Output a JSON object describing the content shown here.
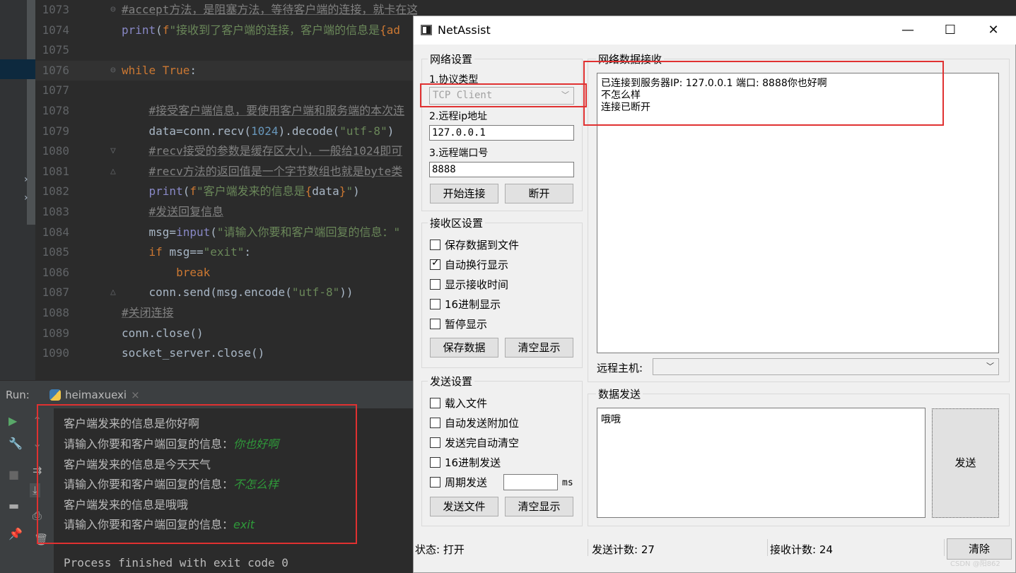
{
  "ide": {
    "lines": [
      {
        "num": "1073",
        "fold": "⊖",
        "html_parts": [
          {
            "cls": "c-cmt",
            "t": "#accept方法，是阻塞方法，等待客户端的连接，就卡在这一行不向下执行了"
          }
        ]
      },
      {
        "num": "1074",
        "fold": "",
        "html_parts": [
          {
            "cls": "c-fn",
            "t": "print"
          },
          {
            "cls": "c-plain",
            "t": "("
          },
          {
            "cls": "c-fs",
            "t": "f"
          },
          {
            "cls": "c-str",
            "t": "\"接收到了客户端的连接，客户端的信息是"
          },
          {
            "cls": "c-fs",
            "t": "{ad"
          }
        ]
      },
      {
        "num": "1075",
        "fold": "",
        "html_parts": []
      },
      {
        "num": "1076",
        "fold": "⊖",
        "html_parts": [
          {
            "cls": "c-kw",
            "t": "while "
          },
          {
            "cls": "c-kw",
            "t": "True"
          },
          {
            "cls": "c-plain",
            "t": ":"
          }
        ]
      },
      {
        "num": "1077",
        "fold": "",
        "html_parts": []
      },
      {
        "num": "1078",
        "fold": "",
        "html_parts": [
          {
            "cls": "c-plain",
            "t": "    "
          },
          {
            "cls": "c-cmt",
            "t": "#接受客户端信息，要使用客户端和服务端的本次连"
          }
        ]
      },
      {
        "num": "1079",
        "fold": "",
        "html_parts": [
          {
            "cls": "c-plain",
            "t": "    data=conn.recv("
          },
          {
            "cls": "c-num",
            "t": "1024"
          },
          {
            "cls": "c-plain",
            "t": ").decode("
          },
          {
            "cls": "c-str",
            "t": "\"utf-8\""
          },
          {
            "cls": "c-plain",
            "t": ")"
          }
        ]
      },
      {
        "num": "1080",
        "fold": "▽",
        "html_parts": [
          {
            "cls": "c-plain",
            "t": "    "
          },
          {
            "cls": "c-cmt",
            "t": "#recv接受的参数是缓存区大小，一般给1024即可"
          }
        ]
      },
      {
        "num": "1081",
        "fold": "△",
        "html_parts": [
          {
            "cls": "c-plain",
            "t": "    "
          },
          {
            "cls": "c-cmt",
            "t": "#recv方法的返回值是一个字节数组也就是byte类"
          }
        ]
      },
      {
        "num": "1082",
        "fold": "",
        "html_parts": [
          {
            "cls": "c-plain",
            "t": "    "
          },
          {
            "cls": "c-fn",
            "t": "print"
          },
          {
            "cls": "c-plain",
            "t": "("
          },
          {
            "cls": "c-fs",
            "t": "f"
          },
          {
            "cls": "c-str",
            "t": "\"客户端发来的信息是"
          },
          {
            "cls": "c-fs",
            "t": "{"
          },
          {
            "cls": "c-plain",
            "t": "data"
          },
          {
            "cls": "c-fs",
            "t": "}"
          },
          {
            "cls": "c-str",
            "t": "\""
          },
          {
            "cls": "c-plain",
            "t": ")"
          }
        ]
      },
      {
        "num": "1083",
        "fold": "",
        "html_parts": [
          {
            "cls": "c-plain",
            "t": "    "
          },
          {
            "cls": "c-cmt",
            "t": "#发送回复信息"
          }
        ]
      },
      {
        "num": "1084",
        "fold": "",
        "html_parts": [
          {
            "cls": "c-plain",
            "t": "    msg="
          },
          {
            "cls": "c-fn",
            "t": "input"
          },
          {
            "cls": "c-plain",
            "t": "("
          },
          {
            "cls": "c-str",
            "t": "\"请输入你要和客户端回复的信息：\""
          }
        ]
      },
      {
        "num": "1085",
        "fold": "",
        "html_parts": [
          {
            "cls": "c-plain",
            "t": "    "
          },
          {
            "cls": "c-kw",
            "t": "if "
          },
          {
            "cls": "c-plain",
            "t": "msg=="
          },
          {
            "cls": "c-str",
            "t": "\"exit\""
          },
          {
            "cls": "c-plain",
            "t": ":"
          }
        ]
      },
      {
        "num": "1086",
        "fold": "",
        "html_parts": [
          {
            "cls": "c-plain",
            "t": "        "
          },
          {
            "cls": "c-kw",
            "t": "break"
          }
        ]
      },
      {
        "num": "1087",
        "fold": "△",
        "html_parts": [
          {
            "cls": "c-plain",
            "t": "    conn.send(msg.encode("
          },
          {
            "cls": "c-str",
            "t": "\"utf-8\""
          },
          {
            "cls": "c-plain",
            "t": "))"
          }
        ]
      },
      {
        "num": "1088",
        "fold": "",
        "html_parts": [
          {
            "cls": "c-cmt",
            "t": "#关闭连接"
          }
        ]
      },
      {
        "num": "1089",
        "fold": "",
        "html_parts": [
          {
            "cls": "c-plain",
            "t": "conn.close()"
          }
        ]
      },
      {
        "num": "1090",
        "fold": "",
        "html_parts": [
          {
            "cls": "c-plain",
            "t": "socket_server.close()"
          }
        ]
      }
    ],
    "run_label": "Run:",
    "run_tab": "heimaxuexi",
    "run_tab_close": "×",
    "output": [
      {
        "text": "客户端发来的信息是你好啊",
        "input": ""
      },
      {
        "text": "请输入你要和客户端回复的信息：",
        "input": "你也好啊"
      },
      {
        "text": "客户端发来的信息是今天天气",
        "input": ""
      },
      {
        "text": "请输入你要和客户端回复的信息：",
        "input": "不怎么样"
      },
      {
        "text": "客户端发来的信息是哦哦",
        "input": ""
      },
      {
        "text": "请输入你要和客户端回复的信息：",
        "input": "exit"
      }
    ],
    "process_finished": "Process finished with exit code 0"
  },
  "netassist": {
    "title": "NetAssist",
    "win_min": "—",
    "win_max": "☐",
    "win_close": "✕",
    "net_settings": {
      "title": "网络设置",
      "protocol_label": "1.协议类型",
      "protocol_value": "TCP Client",
      "ip_label": "2.远程ip地址",
      "ip_value": "127.0.0.1",
      "port_label": "3.远程端口号",
      "port_value": "8888",
      "connect_btn": "开始连接",
      "disconnect_btn": "断开"
    },
    "recv_settings": {
      "title": "接收区设置",
      "options": [
        {
          "label": "保存数据到文件",
          "checked": false
        },
        {
          "label": "自动换行显示",
          "checked": true
        },
        {
          "label": "显示接收时间",
          "checked": false
        },
        {
          "label": "16进制显示",
          "checked": false
        },
        {
          "label": "暂停显示",
          "checked": false
        }
      ],
      "save_btn": "保存数据",
      "clear_btn": "清空显示"
    },
    "send_settings": {
      "title": "发送设置",
      "options": [
        {
          "label": "载入文件",
          "checked": false
        },
        {
          "label": "自动发送附加位",
          "checked": false
        },
        {
          "label": "发送完自动清空",
          "checked": false
        },
        {
          "label": "16进制发送",
          "checked": false
        },
        {
          "label": "周期发送",
          "checked": false
        }
      ],
      "period_value": "",
      "period_unit": "ms",
      "send_file_btn": "发送文件",
      "clear_btn": "清空显示"
    },
    "recv": {
      "title": "网络数据接收",
      "lines": [
        "已连接到服务器IP: 127.0.0.1 端口: 8888你也好啊",
        "不怎么样",
        "连接已断开"
      ],
      "remote_host_label": "远程主机:",
      "remote_host_value": ""
    },
    "send": {
      "title": "数据发送",
      "text": "哦哦",
      "send_btn": "发送"
    },
    "statusbar": {
      "state": "状态: 打开",
      "send_count": "发送计数: 27",
      "recv_count": "接收计数: 24",
      "clear_btn": "清除"
    }
  },
  "watermark": "CSDN @阳862"
}
